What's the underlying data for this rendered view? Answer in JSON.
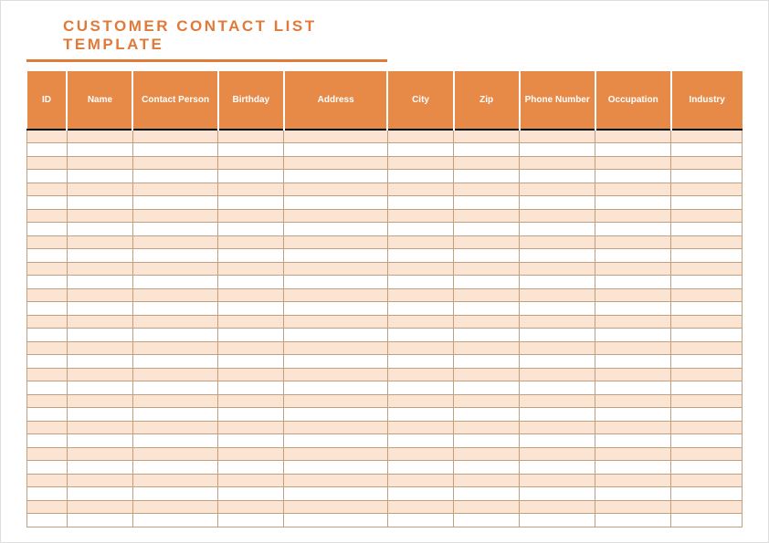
{
  "title": "CUSTOMER CONTACT LIST TEMPLATE",
  "columns": [
    {
      "key": "id",
      "label": "ID",
      "class": "col-id"
    },
    {
      "key": "name",
      "label": "Name",
      "class": "col-name"
    },
    {
      "key": "contact_person",
      "label": "Contact Person",
      "class": "col-contact"
    },
    {
      "key": "birthday",
      "label": "Birthday",
      "class": "col-birthday"
    },
    {
      "key": "address",
      "label": "Address",
      "class": "col-address"
    },
    {
      "key": "city",
      "label": "City",
      "class": "col-city"
    },
    {
      "key": "zip",
      "label": "Zip",
      "class": "col-zip"
    },
    {
      "key": "phone_number",
      "label": "Phone Number",
      "class": "col-phone"
    },
    {
      "key": "occupation",
      "label": "Occupation",
      "class": "col-occupation"
    },
    {
      "key": "industry",
      "label": "Industry",
      "class": "col-industry"
    }
  ],
  "row_count": 30,
  "colors": {
    "accent": "#e88a47",
    "title": "#e07a3a",
    "stripe": "#fce4d3"
  }
}
